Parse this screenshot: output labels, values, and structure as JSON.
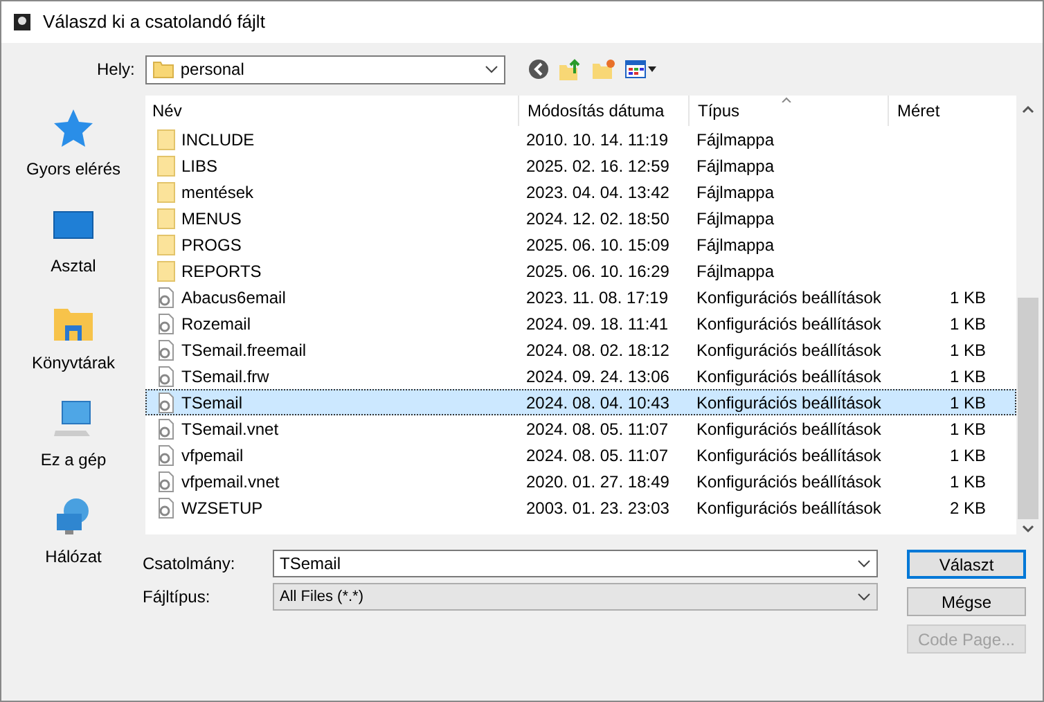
{
  "window": {
    "title": "Válaszd ki a csatolandó fájlt"
  },
  "location": {
    "label": "Hely:",
    "value": "personal"
  },
  "places": [
    {
      "label": "Gyors elérés"
    },
    {
      "label": "Asztal"
    },
    {
      "label": "Könyvtárak"
    },
    {
      "label": "Ez a gép"
    },
    {
      "label": "Hálózat"
    }
  ],
  "table": {
    "columns": [
      "Név",
      "Módosítás dátuma",
      "Típus",
      "Méret"
    ],
    "rows": [
      {
        "kind": "folder",
        "name": "INCLUDE",
        "date": "2010. 10. 14. 11:19",
        "type": "Fájlmappa",
        "selected": false
      },
      {
        "kind": "folder",
        "name": "LIBS",
        "date": "2025. 02. 16. 12:59",
        "type": "Fájlmappa",
        "selected": false
      },
      {
        "kind": "folder",
        "name": "mentések",
        "date": "2023. 04. 04. 13:42",
        "type": "Fájlmappa",
        "selected": false
      },
      {
        "kind": "folder",
        "name": "MENUS",
        "date": "2024. 12. 02. 18:50",
        "type": "Fájlmappa",
        "selected": false
      },
      {
        "kind": "folder",
        "name": "PROGS",
        "date": "2025. 06. 10. 15:09",
        "type": "Fájlmappa",
        "selected": false
      },
      {
        "kind": "folder",
        "name": "REPORTS",
        "date": "2025. 06. 10. 16:29",
        "type": "Fájlmappa",
        "selected": false
      },
      {
        "kind": "config",
        "name": "Abacus6email",
        "date": "2023. 11. 08. 17:19",
        "type": "Konfigurációs beállítások",
        "size": "1 KB",
        "selected": false
      },
      {
        "kind": "config",
        "name": "Rozemail",
        "date": "2024. 09. 18. 11:41",
        "type": "Konfigurációs beállítások",
        "size": "1 KB",
        "selected": false
      },
      {
        "kind": "config",
        "name": "TSemail.freemail",
        "date": "2024. 08. 02. 18:12",
        "type": "Konfigurációs beállítások",
        "size": "1 KB",
        "selected": false
      },
      {
        "kind": "config",
        "name": "TSemail.frw",
        "date": "2024. 09. 24. 13:06",
        "type": "Konfigurációs beállítások",
        "size": "1 KB",
        "selected": false
      },
      {
        "kind": "config",
        "name": "TSemail",
        "date": "2024. 08. 04. 10:43",
        "type": "Konfigurációs beállítások",
        "size": "1 KB",
        "selected": true
      },
      {
        "kind": "config",
        "name": "TSemail.vnet",
        "date": "2024. 08. 05. 11:07",
        "type": "Konfigurációs beállítások",
        "size": "1 KB",
        "selected": false
      },
      {
        "kind": "config",
        "name": "vfpemail",
        "date": "2024. 08. 05. 11:07",
        "type": "Konfigurációs beállítások",
        "size": "1 KB",
        "selected": false
      },
      {
        "kind": "config",
        "name": "vfpemail.vnet",
        "date": "2020. 01. 27. 18:49",
        "type": "Konfigurációs beállítások",
        "size": "1 KB",
        "selected": false
      },
      {
        "kind": "config",
        "name": "WZSETUP",
        "date": "2003. 01. 23. 23:03",
        "type": "Konfigurációs beállítások",
        "size": "2 KB",
        "selected": false
      }
    ]
  },
  "filename": {
    "label": "Csatolmány:",
    "value": "TSemail"
  },
  "filetype": {
    "label": "Fájltípus:",
    "value": "All Files (*.*)"
  },
  "buttons": [
    {
      "label": "Választ",
      "default": true,
      "disabled": false
    },
    {
      "label": "Mégse",
      "default": false,
      "disabled": false
    },
    {
      "label": "Code Page...",
      "default": false,
      "disabled": true
    }
  ]
}
